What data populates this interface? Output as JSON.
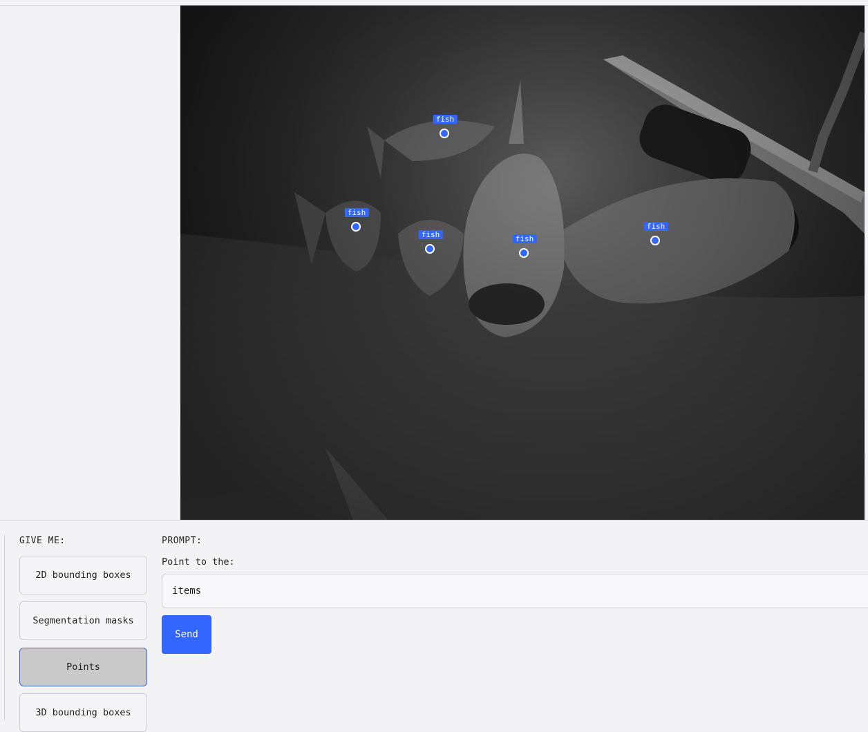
{
  "give_me": {
    "title": "GIVE ME:",
    "options": [
      {
        "label": "2D bounding boxes",
        "active": false
      },
      {
        "label": "Segmentation masks",
        "active": false
      },
      {
        "label": "Points",
        "active": true
      },
      {
        "label": "3D bounding boxes",
        "active": false
      }
    ]
  },
  "prompt": {
    "title": "PROMPT:",
    "instruction": "Point to the:",
    "value": "items",
    "send_label": "Send"
  },
  "points": [
    {
      "label": "fish"
    },
    {
      "label": "fish"
    },
    {
      "label": "fish"
    },
    {
      "label": "fish"
    },
    {
      "label": "fish"
    }
  ],
  "colors": {
    "accent": "#3366ff",
    "active_mode_bg": "#c9c9c9",
    "background": "#f3f3f5"
  }
}
